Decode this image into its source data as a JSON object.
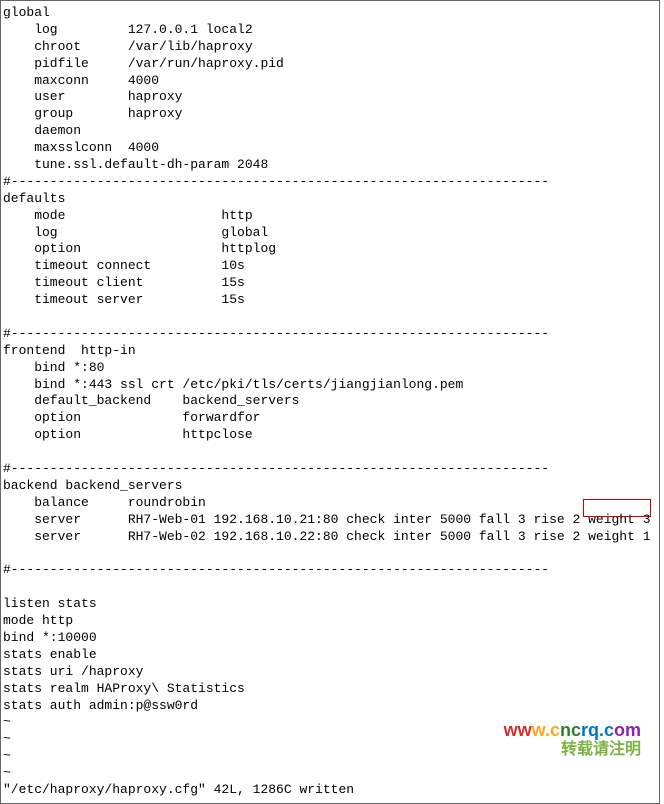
{
  "global": {
    "header": "global",
    "lines": [
      "    log         127.0.0.1 local2",
      "    chroot      /var/lib/haproxy",
      "    pidfile     /var/run/haproxy.pid",
      "    maxconn     4000",
      "    user        haproxy",
      "    group       haproxy",
      "    daemon",
      "    maxsslconn  4000",
      "    tune.ssl.default-dh-param 2048"
    ]
  },
  "sep": "#---------------------------------------------------------------------",
  "defaults": {
    "header": "defaults",
    "lines": [
      "    mode                    http",
      "    log                     global",
      "    option                  httplog",
      "    timeout connect         10s",
      "    timeout client          15s",
      "    timeout server          15s"
    ]
  },
  "frontend": {
    "header": "frontend  http-in",
    "lines": [
      "    bind *:80",
      "    bind *:443 ssl crt /etc/pki/tls/certs/jiangjianlong.pem",
      "    default_backend    backend_servers",
      "    option             forwardfor",
      "    option             httpclose"
    ]
  },
  "backend": {
    "header": "backend backend_servers",
    "lines": [
      "    balance     roundrobin",
      "    server      RH7-Web-01 192.168.10.21:80 check inter 5000 fall 3 rise 2 weight 3",
      "    server      RH7-Web-02 192.168.10.22:80 check inter 5000 fall 3 rise 2 weight 1"
    ]
  },
  "listen": {
    "lines": [
      "listen stats",
      "mode http",
      "bind *:10000",
      "stats enable",
      "stats uri /haproxy",
      "stats realm HAProxy\\ Statistics",
      "stats auth admin:p@ssw0rd"
    ]
  },
  "tilde": "~",
  "status": "\"/etc/haproxy/haproxy.cfg\" 42L, 1286C written",
  "watermark": {
    "url": "www.cncrq.com",
    "sub": "转载请注明"
  }
}
